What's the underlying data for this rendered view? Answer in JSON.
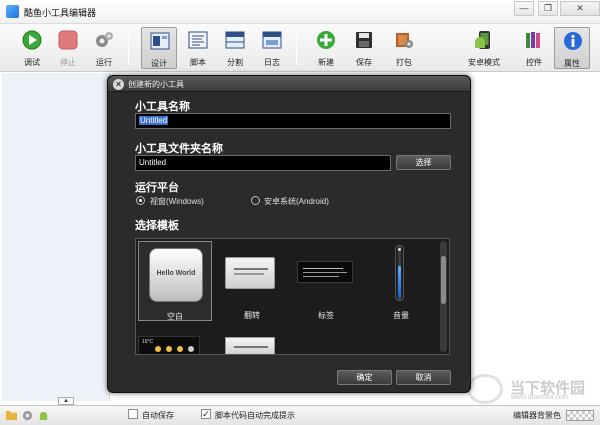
{
  "window": {
    "title": "酷鱼小工具编辑器",
    "minimize_glyph": "—",
    "restore_glyph": "❐",
    "close_glyph": "✕"
  },
  "toolbar": {
    "debug": "调试",
    "stop": "停止",
    "run": "运行",
    "design": "设计",
    "script": "脚本",
    "split": "分割",
    "log": "日志",
    "new": "新建",
    "save": "保存",
    "pack": "打包",
    "android_mode": "安卓模式",
    "widgets": "控件",
    "properties": "属性"
  },
  "dialog": {
    "title": "创建新的小工具",
    "name_label": "小工具名称",
    "name_value": "Untitled",
    "folder_label": "小工具文件夹名称",
    "folder_value": "Untitled",
    "choose_button": "选择",
    "platform_label": "运行平台",
    "platform_windows": "视窗(Windows)",
    "platform_android": "安卓系统(Android)",
    "platform_selected": "windows",
    "template_label": "选择模板",
    "templates": [
      {
        "label": "空白",
        "preview_text": "Hello World"
      },
      {
        "label": "翻转",
        "preview_text": ""
      },
      {
        "label": "标签",
        "preview_text": ""
      },
      {
        "label": "音量",
        "preview_text": ""
      },
      {
        "label": "",
        "preview_text": "16°C"
      },
      {
        "label": "",
        "preview_text": ""
      }
    ],
    "ok_button": "确定",
    "cancel_button": "取消"
  },
  "statusbar": {
    "autosave_label": "自动保存",
    "autosave_checked": false,
    "autocomplete_label": "脚本代码自动完成提示",
    "autocomplete_checked": true,
    "bg_color_label": "编辑器背景色",
    "scroll_glyph": "▲",
    "check_glyph": "✓"
  },
  "watermark": {
    "text": "当下软件园",
    "url": "www.downxia.com"
  },
  "colors": {
    "dialog_bg": "#2b2b2b",
    "accent_blue": "#3a6fd0",
    "editor_left_bg": "#eef1f8"
  }
}
